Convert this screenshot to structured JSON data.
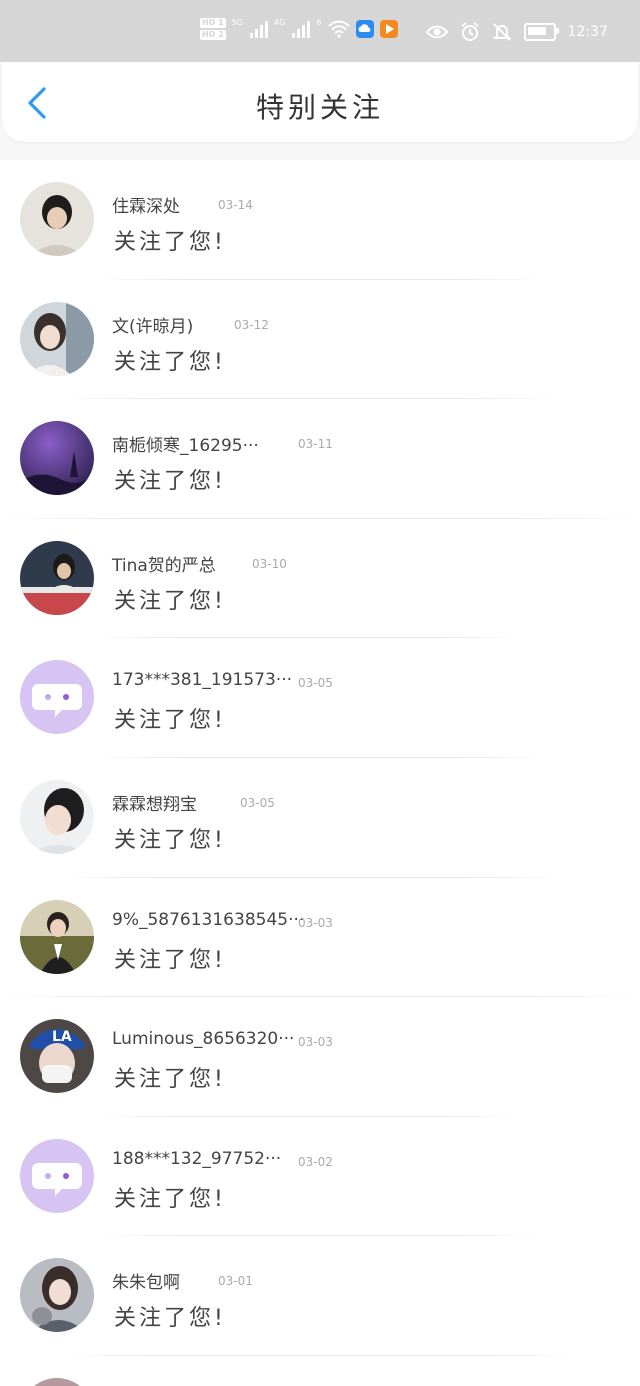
{
  "status_bar": {
    "hd1": "HD 1",
    "hd2": "HD 2",
    "net1": "5G",
    "net2": "4G",
    "net3": "6",
    "time": "12:37"
  },
  "header": {
    "title": "特别关注"
  },
  "list": [
    {
      "name": "住霖深处",
      "date": "03-14",
      "msg": "关注了您!"
    },
    {
      "name": "文(许晾月)",
      "date": "03-12",
      "msg": "关注了您!"
    },
    {
      "name": "南栀倾寒_16295···",
      "date": "03-11",
      "msg": "关注了您!"
    },
    {
      "name": "Tina贺的严总",
      "date": "03-10",
      "msg": "关注了您!"
    },
    {
      "name": "173***381_191573···",
      "date": "03-05",
      "msg": "关注了您!"
    },
    {
      "name": "霖霖想翔宝",
      "date": "03-05",
      "msg": "关注了您!"
    },
    {
      "name": "9%_58761316385​45···",
      "date": "03-03",
      "msg": "关注了您!"
    },
    {
      "name": "Luminous_8656320···",
      "date": "03-03",
      "msg": "关注了您!"
    },
    {
      "name": "188***132_97752···",
      "date": "03-02",
      "msg": "关注了您!"
    },
    {
      "name": "朱朱包啊",
      "date": "03-01",
      "msg": "关注了您!"
    }
  ],
  "colors": {
    "accent": "#2b9cf2",
    "default_avatar_bg": "#d7c4f2"
  }
}
